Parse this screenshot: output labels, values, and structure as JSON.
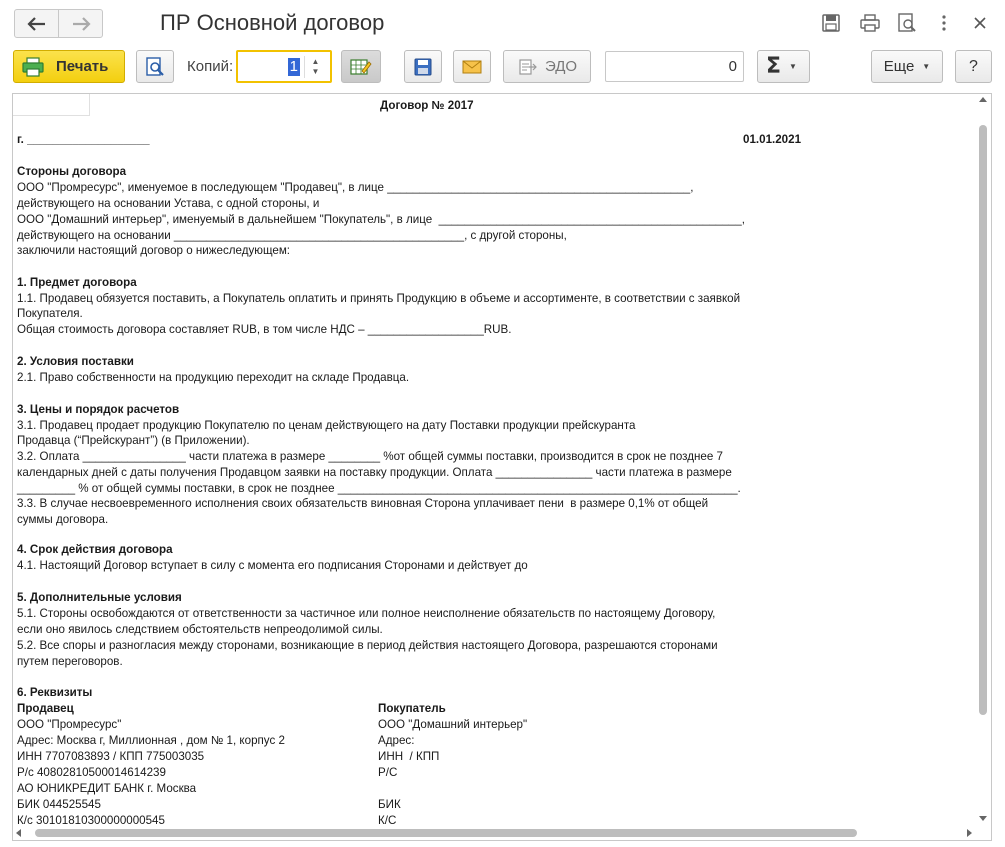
{
  "window": {
    "title": "ПР Основной договор"
  },
  "toolbar": {
    "print_label": "Печать",
    "copies_label": "Копий:",
    "copies_value": "1",
    "edo_label": "ЭДО",
    "sum_value": "0",
    "sigma_label": "Σ",
    "more_label": "Еще",
    "help_label": "?"
  },
  "document": {
    "lines": [
      {
        "text": "Договор № 2017",
        "bold": true
      },
      {
        "text": "г. ___________________",
        "bold": true
      },
      {
        "text": "01.01.2021",
        "bold": true
      },
      {
        "text": "Стороны договора",
        "bold": true
      },
      {
        "text": "ООО \"Промресурс\", именуемое в последующем \"Продавец\", в лице _______________________________________________,",
        "bold": false
      },
      {
        "text": "действующего на основании Устава, с одной стороны, и",
        "bold": false
      },
      {
        "text": "ООО \"Домашний интерьер\", именуемый в дальнейшем \"Покупатель\", в лице  _______________________________________________,",
        "bold": false
      },
      {
        "text": "действующего на основании _____________________________________________, с другой стороны,",
        "bold": false
      },
      {
        "text": "заключили настоящий договор о нижеследующем:",
        "bold": false
      },
      {
        "text": "1. Предмет договора",
        "bold": true
      },
      {
        "text": "1.1. Продавец обязуется поставить, а Покупатель оплатить и принять Продукцию в объеме и ассортименте, в соответствии с заявкой",
        "bold": false
      },
      {
        "text": "Покупателя.",
        "bold": false
      },
      {
        "text": "Общая стоимость договора составляет RUB, в том числе НДС – __________________RUB.",
        "bold": false
      },
      {
        "text": "2. Условия поставки",
        "bold": true
      },
      {
        "text": "2.1. Право собственности на продукцию переходит на складе Продавца.",
        "bold": false
      },
      {
        "text": "3. Цены и порядок расчетов",
        "bold": true
      },
      {
        "text": "3.1. Продавец продает продукцию Покупателю по ценам действующего на дату Поставки продукции прейскуранта",
        "bold": false
      },
      {
        "text": "Продавца (“Прейскурант”) (в Приложении).",
        "bold": false
      },
      {
        "text": "3.2. Оплата ________________ части платежа в размере ________ %от общей суммы поставки, производится в срок не позднее 7",
        "bold": false
      },
      {
        "text": "календарных дней с даты получения Продавцом заявки на поставку продукции. Оплата _______________ части платежа в размере",
        "bold": false
      },
      {
        "text": "_________ % от общей суммы поставки, в срок не позднее ______________________________________________________________.",
        "bold": false
      },
      {
        "text": "3.3. В случае несвоевременного исполнения своих обязательств виновная Сторона уплачивает пени  в размере 0,1% от общей",
        "bold": false
      },
      {
        "text": "суммы договора.",
        "bold": false
      },
      {
        "text": "4. Срок действия договора",
        "bold": true
      },
      {
        "text": "4.1. Настоящий Договор вступает в силу с момента его подписания Сторонами и действует до",
        "bold": false
      },
      {
        "text": "5. Дополнительные условия",
        "bold": true
      },
      {
        "text": "5.1. Стороны освобождаются от ответственности за частичное или полное неисполнение обязательств по настоящему Договору,",
        "bold": false
      },
      {
        "text": "если оно явилось следствием обстоятельств непреодолимой силы.",
        "bold": false
      },
      {
        "text": "5.2. Все споры и разногласия между сторонами, возникающие в период действия настоящего Договора, разрешаются сторонами",
        "bold": false
      },
      {
        "text": "путем переговоров.",
        "bold": false
      },
      {
        "text": "6. Реквизиты",
        "bold": true
      }
    ],
    "seller": {
      "heading": "Продавец",
      "rows": [
        "ООО \"Промресурс\"",
        "Адрес: Москва г, Миллионная , дом № 1, корпус 2",
        "ИНН 7707083893 / КПП 775003035",
        "Р/с 40802810500014614239",
        "АО ЮНИКРЕДИТ БАНК г. Москва",
        "БИК 044525545",
        "К/с 30101810300000000545"
      ]
    },
    "buyer": {
      "heading": "Покупатель",
      "rows": [
        "ООО \"Домашний интерьер\"",
        "Адрес:",
        "ИНН  / КПП",
        "Р/С",
        "",
        "БИК",
        "К/С"
      ]
    }
  },
  "colors": {
    "print_button": "#f3cf0f",
    "copies_focus_border": "#f2c200",
    "selection": "#3367d6"
  },
  "icons": [
    "back-arrow-icon",
    "forward-arrow-icon",
    "save-icon",
    "print-icon",
    "preview-icon",
    "more-vertical-icon",
    "close-icon",
    "printer-icon",
    "print-preview-icon",
    "edit-table-icon",
    "floppy-icon",
    "envelope-icon",
    "edo-icon",
    "sigma-icon"
  ]
}
